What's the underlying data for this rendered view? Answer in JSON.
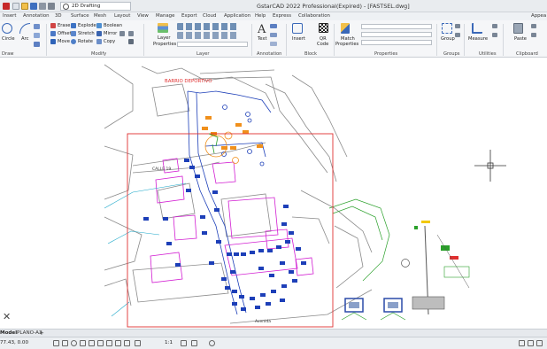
{
  "app": {
    "title": "GstarCAD 2022 Professional(Expired) - [FASTSEL.dwg]",
    "workspace": "2D Drafting"
  },
  "menu_tabs": [
    "Insert",
    "Annotation",
    "3D",
    "Surface",
    "Mesh",
    "Layout",
    "View",
    "Manage",
    "Export",
    "Cloud",
    "Application",
    "Help",
    "Express",
    "Collaboration"
  ],
  "menu_right": "Appea",
  "ribbon": {
    "draw": {
      "circle": "Circle",
      "arc": "Arc",
      "panel": "Draw"
    },
    "modify": {
      "erase": "Erase",
      "explode": "Explode",
      "boolean": "Boolean",
      "offset": "Offset",
      "stretch": "Stretch",
      "mirror": "Mirror",
      "move": "Move",
      "rotate": "Rotate",
      "copy": "Copy",
      "panel": "Modify"
    },
    "layer": {
      "properties": "Layer",
      "properties2": "Properties",
      "panel": "Layer"
    },
    "annotation": {
      "text": "Text",
      "panel": "Annotation"
    },
    "block": {
      "insert": "Insert",
      "qr": "QR",
      "qr2": "Code",
      "panel": "Block"
    },
    "properties": {
      "match": "Match",
      "match2": "Properties",
      "panel": "Properties"
    },
    "groups": {
      "group": "Group",
      "panel": "Groups"
    },
    "utilities": {
      "measure": "Measure",
      "panel": "Utilities"
    },
    "clipboard": {
      "paste": "Paste",
      "panel": "Clipboard"
    }
  },
  "drawing": {
    "label_barrio": "BARRIO DEPORTIVO",
    "label_calle": "CALLE 19",
    "label_avenida": "Avenida"
  },
  "layout_tabs": {
    "model": "Model",
    "layout": "PLANO-A3",
    "add": "+"
  },
  "status": {
    "coords": "77.43, 0.00",
    "scale": "1:1"
  },
  "colors": {
    "accent": "#2b6cc4",
    "paper_border": "#e03030",
    "drawing_blue": "#1d3fb8",
    "drawing_magenta": "#d21ed2",
    "drawing_orange": "#f0901c",
    "drawing_green": "#2aa02a"
  }
}
